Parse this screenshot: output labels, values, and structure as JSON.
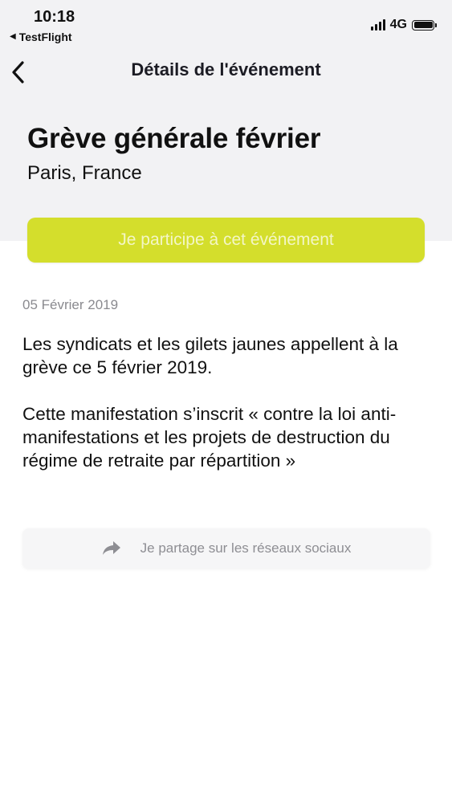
{
  "status_bar": {
    "time": "10:18",
    "back_app": "TestFlight",
    "network": "4G"
  },
  "nav": {
    "title": "Détails de l'événement"
  },
  "event": {
    "title": "Grève générale février",
    "location": "Paris, France",
    "participate_label": "Je participe à cet événement",
    "date": "05 Février 2019",
    "description": [
      "Les syndicats et les gilets jaunes appellent à la grève ce 5 février 2019.",
      "Cette manifestation s’inscrit « contre la loi anti-manifestations et les projets de destruction du régime de retraite par répartition »"
    ],
    "share_label": "Je partage sur les réseaux sociaux"
  },
  "colors": {
    "accent": "#d4de2c",
    "header_background": "#f2f2f4",
    "muted_text": "#8a8a8f"
  },
  "icons": {
    "back": "chevron-left-icon",
    "share": "share-arrow-icon"
  }
}
